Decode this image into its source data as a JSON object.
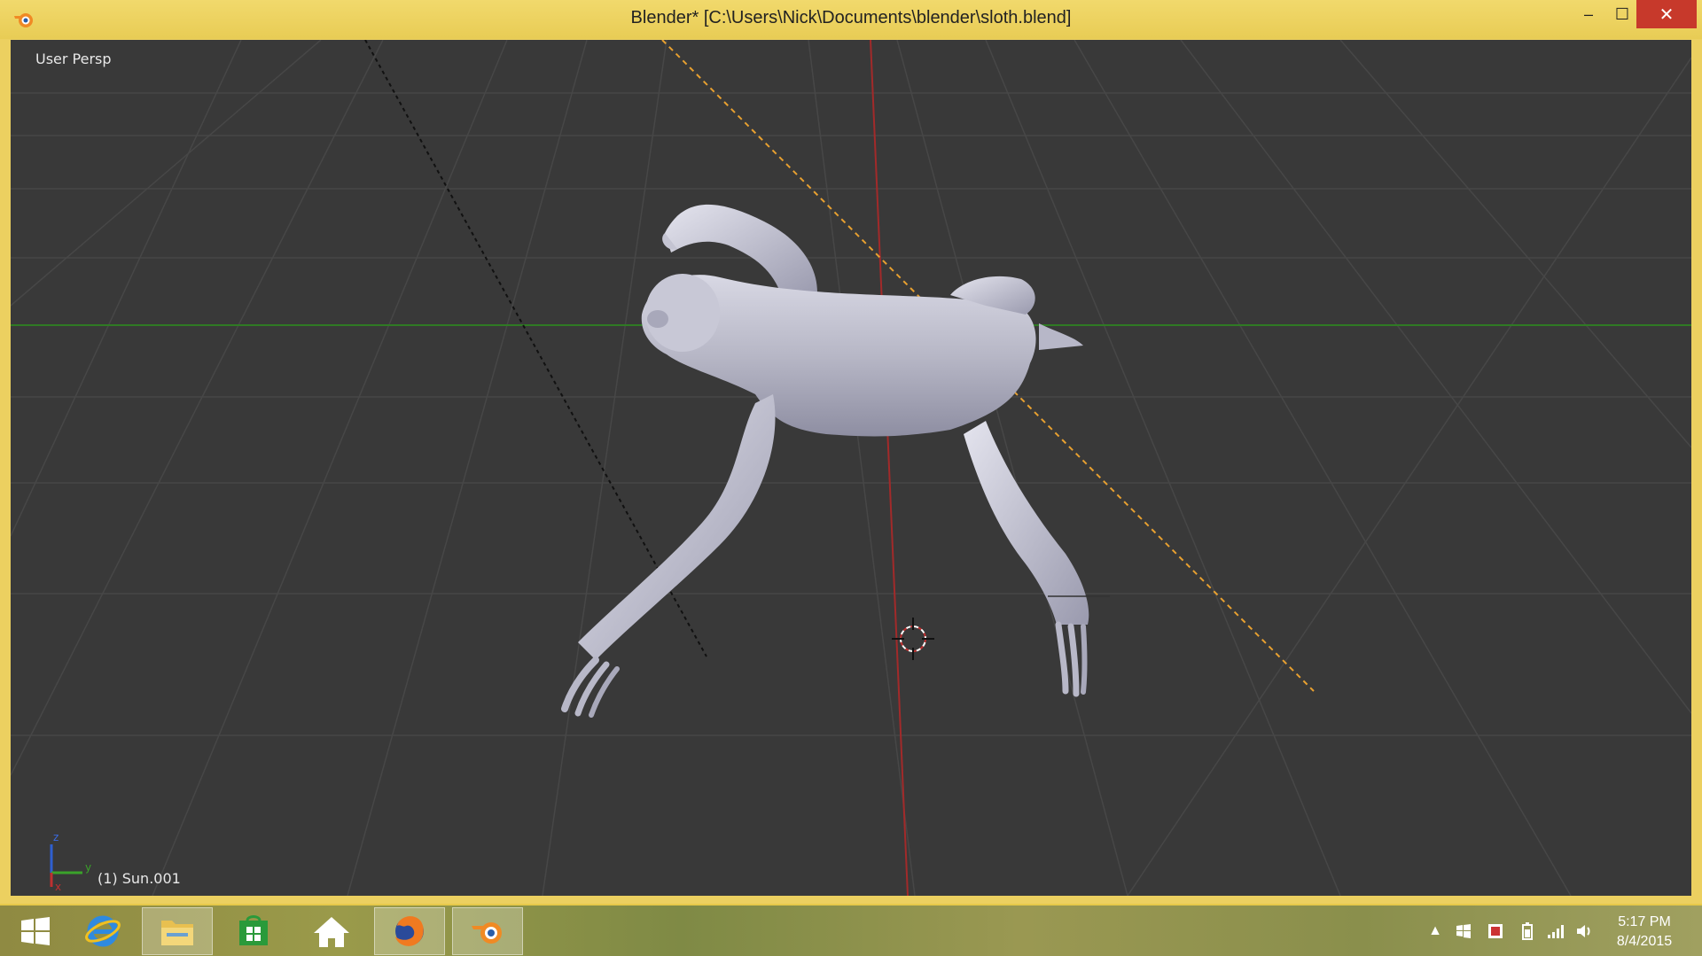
{
  "window": {
    "title": "Blender* [C:\\Users\\Nick\\Documents\\blender\\sloth.blend]",
    "minimize_glyph": "–",
    "maximize_glyph": "☐",
    "close_glyph": "✕"
  },
  "viewport": {
    "view_label": "User Persp",
    "object_label": "(1) Sun.001",
    "gizmo_axes": {
      "z": "z",
      "y": "y",
      "x": "x"
    }
  },
  "taskbar": {
    "items": [
      {
        "name": "start",
        "icon": "windows-logo-icon"
      },
      {
        "name": "internet-explorer",
        "icon": "internet-explorer-icon"
      },
      {
        "name": "file-explorer",
        "icon": "folder-icon"
      },
      {
        "name": "store",
        "icon": "store-icon"
      },
      {
        "name": "home",
        "icon": "home-icon"
      },
      {
        "name": "firefox",
        "icon": "firefox-icon"
      },
      {
        "name": "blender",
        "icon": "blender-icon",
        "active": true
      }
    ],
    "tray": {
      "time": "5:17 PM",
      "date": "8/4/2015",
      "icons": [
        "chevron-up-icon",
        "windows-flag-icon",
        "security-icon",
        "battery-icon",
        "network-icon",
        "volume-icon"
      ]
    }
  },
  "colors": {
    "title_bar": "#ecd060",
    "viewport_bg": "#393939",
    "grid_line": "#4a4a4a",
    "x_axis": "#b03030",
    "y_axis": "#3a8a2a",
    "close_button": "#c7392b"
  }
}
